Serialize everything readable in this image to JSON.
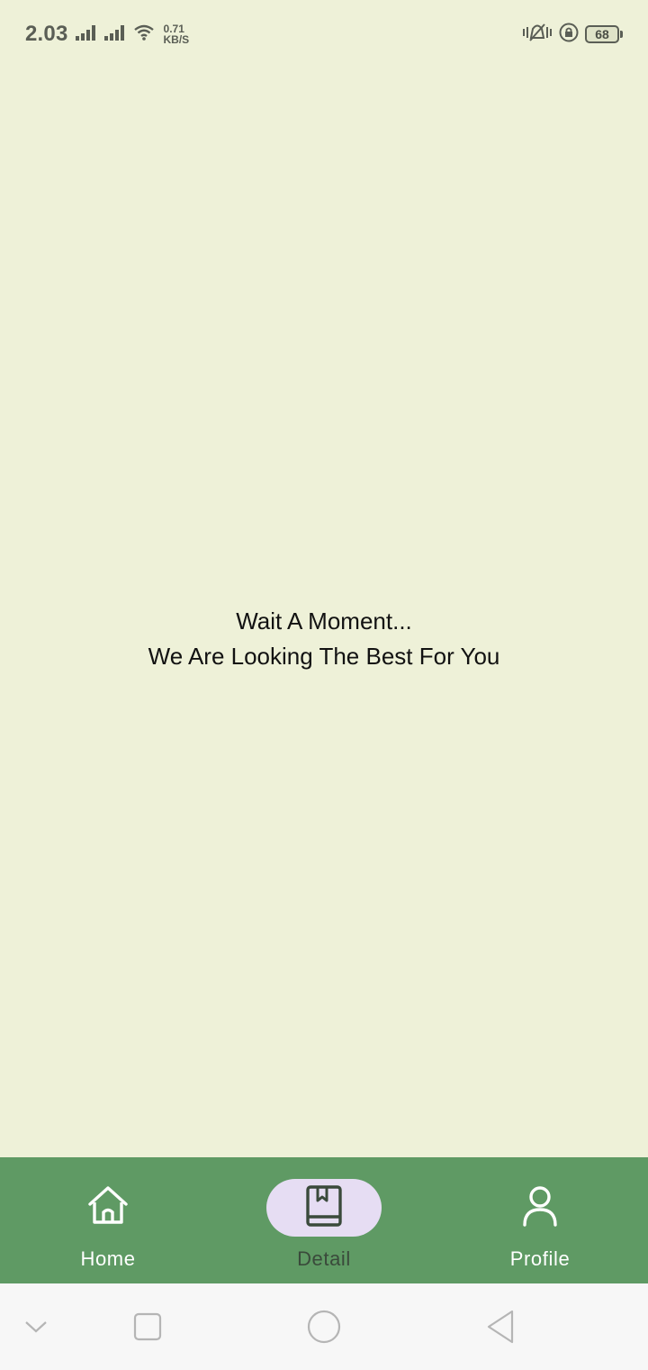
{
  "status_bar": {
    "time": "2.03",
    "net_speed_value": "0.71",
    "net_speed_unit": "KB/S",
    "battery": "68",
    "icons": [
      "signal-icon",
      "signal-icon",
      "wifi-icon",
      "vibrate-icon",
      "rotation-lock-icon",
      "battery-icon"
    ]
  },
  "main": {
    "loading_line1": "Wait A Moment...",
    "loading_line2": "We Are Looking The Best For You"
  },
  "bottom_nav": {
    "items": [
      {
        "label": "Home",
        "icon": "home-icon",
        "active": false
      },
      {
        "label": "Detail",
        "icon": "book-icon",
        "active": true
      },
      {
        "label": "Profile",
        "icon": "person-icon",
        "active": false
      }
    ]
  },
  "system_nav": {
    "icons": [
      "chevron-down-icon",
      "recents-icon",
      "home-circle-icon",
      "back-icon"
    ]
  },
  "colors": {
    "background": "#eef1d8",
    "nav_bar": "#5f9a64",
    "active_pill": "#e6ddf3",
    "system_bar": "#f7f7f7"
  }
}
